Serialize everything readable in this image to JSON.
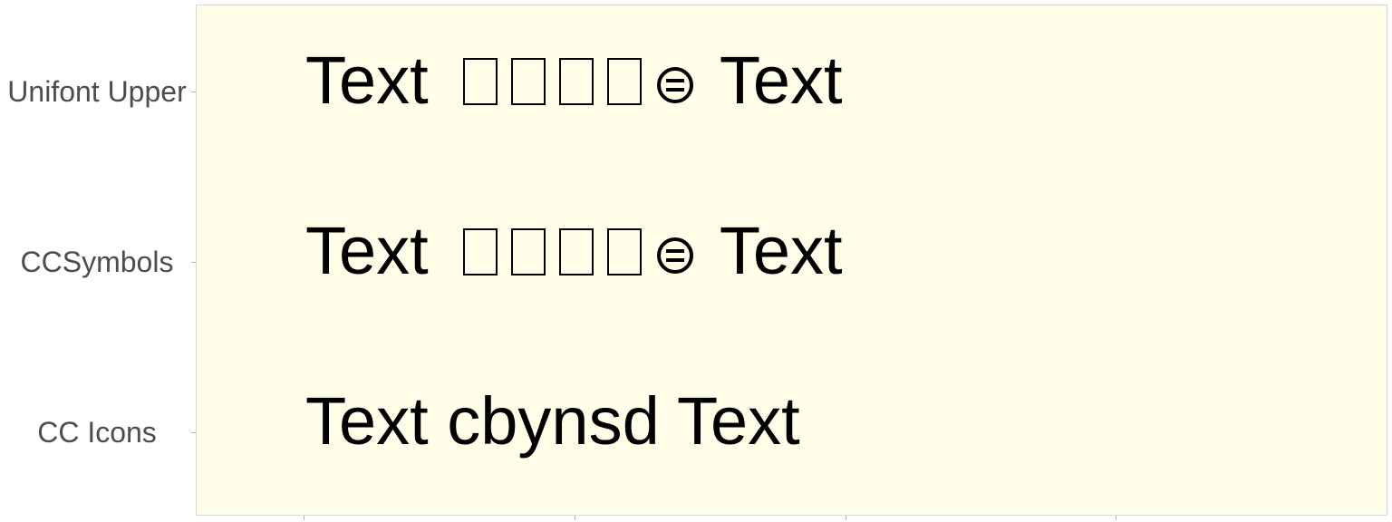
{
  "chart_data": {
    "type": "table",
    "panel_background": "#fffee8",
    "rows": [
      {
        "label": "Unifont Upper",
        "text_before": "Text",
        "unrendered_glyph_count": 4,
        "trailing_icon": "cc-nd-icon",
        "text_after": "Text"
      },
      {
        "label": "CCSymbols",
        "text_before": "Text",
        "unrendered_glyph_count": 4,
        "trailing_icon": "cc-nd-icon",
        "text_after": "Text"
      },
      {
        "label": "CC Icons",
        "text": "Text cbynsd Text"
      }
    ]
  }
}
